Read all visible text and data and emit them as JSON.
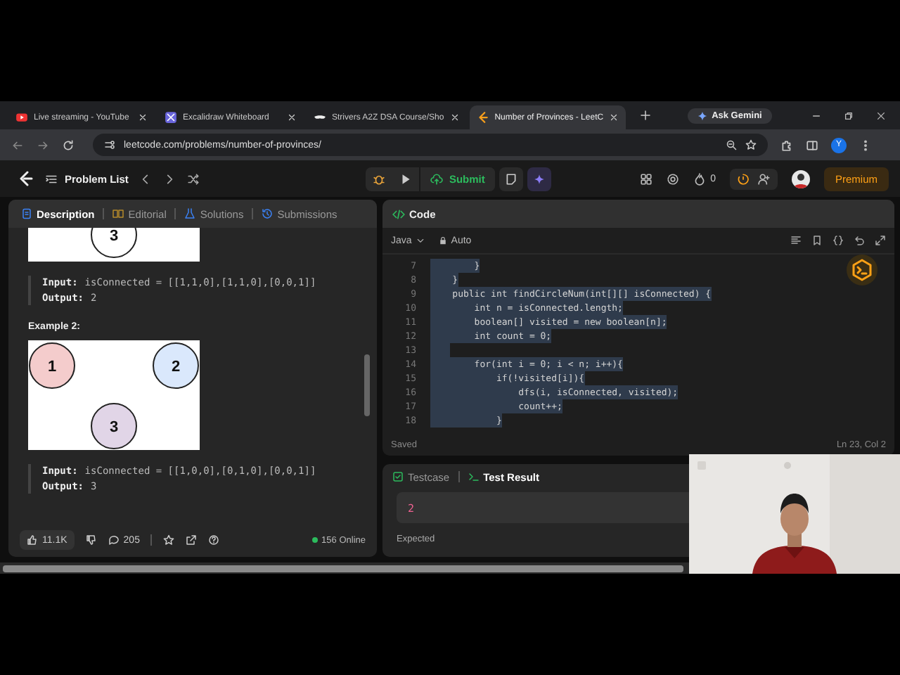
{
  "browser": {
    "tabs": [
      {
        "title": "Live streaming - YouTube",
        "selected": false
      },
      {
        "title": "Excalidraw Whiteboard",
        "selected": false
      },
      {
        "title": "Strivers A2Z DSA Course/Sho",
        "selected": false
      },
      {
        "title": "Number of Provinces - LeetC",
        "selected": true
      }
    ],
    "gemini": "Ask Gemini",
    "url": "leetcode.com/problems/number-of-provinces/",
    "profile": "Y"
  },
  "toolbar": {
    "problem_list": "Problem List",
    "submit": "Submit",
    "streak": "0",
    "premium": "Premium"
  },
  "description": {
    "tabs": [
      {
        "label": "Description",
        "selected": true
      },
      {
        "label": "Editorial",
        "selected": false
      },
      {
        "label": "Solutions",
        "selected": false
      },
      {
        "label": "Submissions",
        "selected": false
      }
    ],
    "example_1": {
      "nodes": [
        {
          "label": "3"
        }
      ],
      "input_label": "Input:",
      "input": "isConnected = [[1,1,0],[1,1,0],[0,0,1]]",
      "output_label": "Output:",
      "output": "2"
    },
    "example_2": {
      "title": "Example 2:",
      "nodes": [
        {
          "label": "1",
          "color": "#f4cccc"
        },
        {
          "label": "2",
          "color": "#dae8fc"
        },
        {
          "label": "3",
          "color": "#e1d5e7"
        }
      ],
      "input_label": "Input:",
      "input": "isConnected = [[1,0,0],[0,1,0],[0,0,1]]",
      "output_label": "Output:",
      "output": "3"
    },
    "likes": "11.1K",
    "comments": "205",
    "online": "156 Online"
  },
  "code": {
    "title": "Code",
    "language": "Java",
    "mode": "Auto",
    "lines": [
      {
        "n": "7",
        "text": "        }",
        "highlighted": true
      },
      {
        "n": "8",
        "text": "    }",
        "highlighted": true
      },
      {
        "n": "9",
        "text": "    public int findCircleNum(int[][] isConnected) {",
        "highlighted": true
      },
      {
        "n": "10",
        "text": "        int n = isConnected.length;",
        "highlighted": true
      },
      {
        "n": "11",
        "text": "        boolean[] visited = new boolean[n];",
        "highlighted": true
      },
      {
        "n": "12",
        "text": "        int count = 0;",
        "highlighted": true
      },
      {
        "n": "13",
        "highlighted": true
      },
      {
        "n": "14",
        "text": "        for(int i = 0; i < n; i++){",
        "highlighted": true
      },
      {
        "n": "15",
        "text": "            if(!visited[i]){",
        "highlighted": true
      },
      {
        "n": "16",
        "text": "                dfs(i, isConnected, visited);",
        "highlighted": true
      },
      {
        "n": "17",
        "text": "                count++;",
        "highlighted": true
      },
      {
        "n": "18",
        "text": "            }",
        "highlighted": true
      }
    ],
    "status": "Saved",
    "cursor": "Ln 23, Col 2"
  },
  "test": {
    "tabs": [
      {
        "label": "Testcase",
        "selected": false
      },
      {
        "label": "Test Result",
        "selected": true
      }
    ],
    "value": "2",
    "expected_label": "Expected"
  }
}
